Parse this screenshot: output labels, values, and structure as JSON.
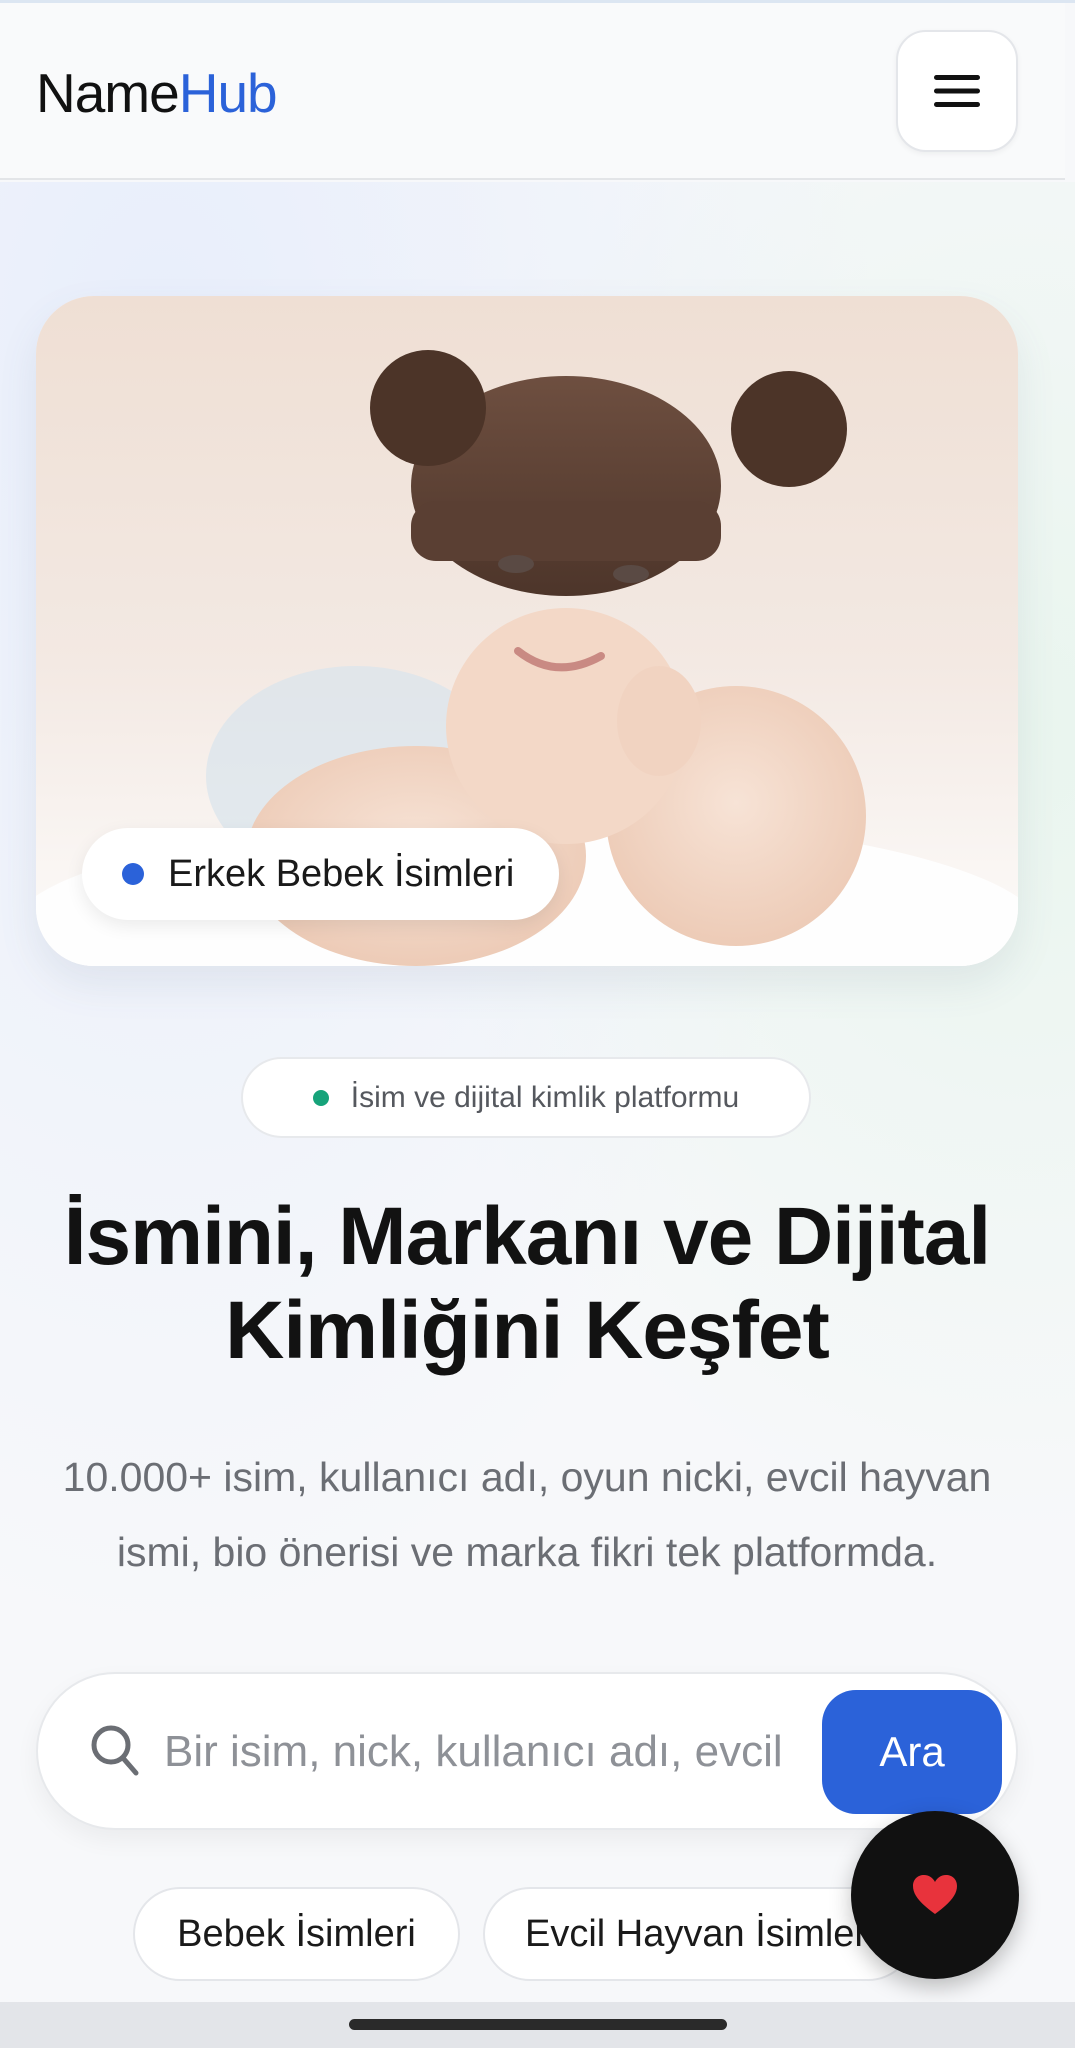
{
  "header": {
    "logo_part1": "Name",
    "logo_part2": "Hub",
    "menu_icon": "hamburger-menu-icon"
  },
  "hero": {
    "image_subject": "smiling baby wearing brown knit hat with pom-poms",
    "badge_label": "Erkek Bebek İsimleri"
  },
  "intro": {
    "platform_pill": "İsim ve dijital kimlik platformu",
    "headline_line1": "İsmini, Markanı ve Dijital",
    "headline_line2": "Kimliğini Keşfet",
    "subtext": "10.000+ isim, kullanıcı adı, oyun nicki, evcil hayvan ismi, bio önerisi ve marka fikri tek platformda."
  },
  "search": {
    "placeholder": "Bir isim, nick, kullanıcı adı, evcil",
    "button_label": "Ara"
  },
  "chips": [
    {
      "label": "Bebek İsimleri"
    },
    {
      "label": "Evcil Hayvan İsimleri"
    }
  ],
  "fab": {
    "icon": "heart-icon"
  },
  "colors": {
    "accent_blue": "#2b62d9",
    "green_dot": "#16a37a",
    "heart_red": "#e8333c",
    "fab_black": "#111111"
  }
}
